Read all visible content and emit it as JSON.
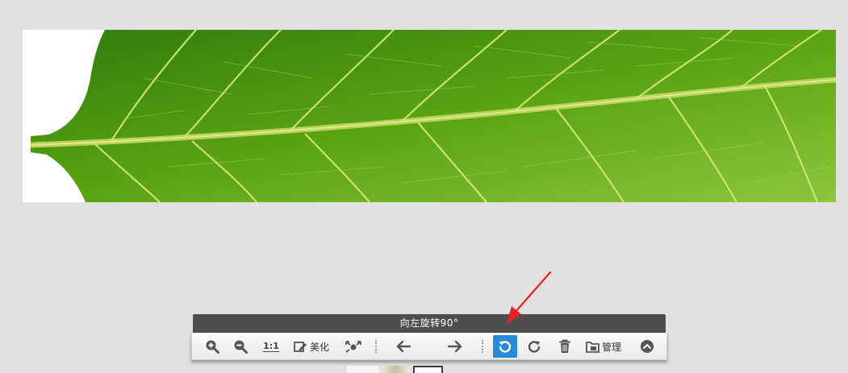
{
  "tooltip": {
    "text": "向左旋转90°"
  },
  "toolbar": {
    "zoom_in_icon": "zoom-in-icon",
    "zoom_out_icon": "zoom-out-icon",
    "actual_size_label": "1:1",
    "beautify_label": "美化",
    "fullscreen_icon": "fullscreen-icon",
    "prev_icon": "arrow-left-icon",
    "next_icon": "arrow-right-icon",
    "rotate_left_icon": "rotate-left-icon",
    "rotate_right_icon": "rotate-right-icon",
    "delete_icon": "trash-icon",
    "manage_label": "管理",
    "collapse_icon": "chevron-up-icon"
  },
  "colors": {
    "background": "#e1e1e1",
    "tooltip_bg": "#4e4e4e",
    "active_button": "#2a8ad8",
    "annotation_arrow": "#e8202a",
    "leaf_green": "#5aa312"
  }
}
